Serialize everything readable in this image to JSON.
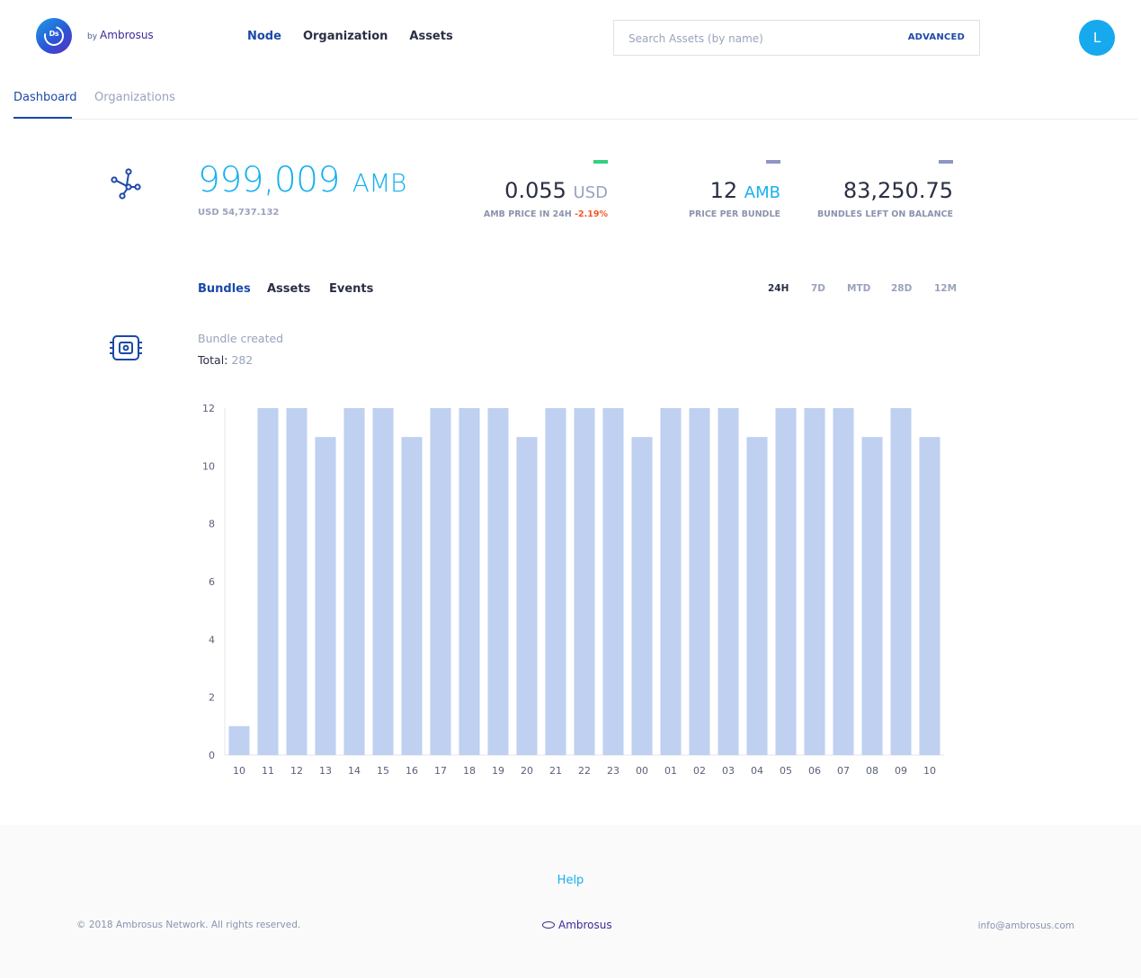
{
  "header": {
    "logo_text": "Ds",
    "by_label": "by",
    "brand": "Ambrosus",
    "nav": [
      "Node",
      "Organization",
      "Assets"
    ],
    "search_placeholder": "Search Assets (by name)",
    "advanced_label": "ADVANCED",
    "avatar_initial": "L"
  },
  "subtabs": [
    "Dashboard",
    "Organizations"
  ],
  "stats": {
    "balance_value": "999,009",
    "balance_unit": "AMB",
    "balance_usd": "USD 54,737.132",
    "price_value": "0.055",
    "price_unit": "USD",
    "price_label": "AMB PRICE IN 24H",
    "price_change": "-2.19%",
    "bundle_price_value": "12",
    "bundle_price_unit": "AMB",
    "bundle_price_label": "PRICE PER BUNDLE",
    "bundles_left_value": "83,250.75",
    "bundles_left_label": "BUNDLES LEFT ON BALANCE",
    "indicator_colors": [
      "#33d17a",
      "#8f95c4",
      "#8f95c4"
    ]
  },
  "chart_tabs": [
    "Bundles",
    "Assets",
    "Events"
  ],
  "periods": [
    "24H",
    "7D",
    "MTD",
    "28D",
    "12M"
  ],
  "chart_title": "Bundle created",
  "total_label": "Total:",
  "total_value": "282",
  "chart_data": {
    "type": "bar",
    "categories": [
      "10",
      "11",
      "12",
      "13",
      "14",
      "15",
      "16",
      "17",
      "18",
      "19",
      "20",
      "21",
      "22",
      "23",
      "00",
      "01",
      "02",
      "03",
      "04",
      "05",
      "06",
      "07",
      "08",
      "09",
      "10"
    ],
    "values": [
      1,
      12,
      12,
      11,
      12,
      12,
      11,
      12,
      12,
      12,
      11,
      12,
      12,
      12,
      11,
      12,
      12,
      12,
      11,
      12,
      12,
      12,
      11,
      12,
      11
    ],
    "ylim": [
      0,
      12
    ],
    "yticks": [
      0,
      2,
      4,
      6,
      8,
      10,
      12
    ],
    "bar_color": "#bfd0f0",
    "grid": false
  },
  "footer": {
    "help": "Help",
    "copyright": "© 2018 Ambrosus Network. All rights reserved.",
    "brand": "Ambrosus",
    "email": "info@ambrosus.com"
  }
}
